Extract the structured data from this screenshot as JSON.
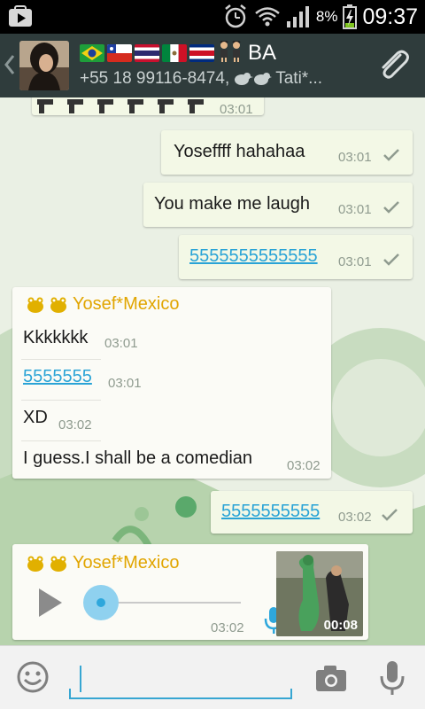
{
  "status_bar": {
    "battery_pct": "8%",
    "time": "09:37",
    "icons": [
      "play-store-icon",
      "alarm-icon",
      "wifi-icon",
      "signal-icon",
      "battery-charging-icon"
    ]
  },
  "header": {
    "title": "BA",
    "subtitle_text": "+55 18 99116-8474,",
    "subtitle_tail": "Tati*...",
    "flags": [
      "brazil",
      "chile",
      "thailand",
      "mexico",
      "costa-rica"
    ],
    "icons": [
      "back-chevron-icon",
      "avatar",
      "dancers-emoji-icon",
      "bird-emoji-icon",
      "attach-paperclip-icon"
    ]
  },
  "messages": {
    "partial_top": {
      "time": "03:01"
    },
    "out1": {
      "text": "Yoseffff hahahaa",
      "time": "03:01"
    },
    "out2": {
      "text": "You make me laugh",
      "time": "03:01"
    },
    "out3": {
      "text": "5555555555555",
      "time": "03:01"
    },
    "in_group1": {
      "sender": "Yosef*Mexico",
      "items": [
        {
          "text": "Kkkkkkk",
          "time": "03:01"
        },
        {
          "text": "5555555",
          "time": "03:01"
        },
        {
          "text": "XD",
          "time": "03:02"
        },
        {
          "text": "I guess.I shall be a comedian",
          "time": "03:02"
        }
      ]
    },
    "out4": {
      "text": "5555555555",
      "time": "03:02"
    },
    "in_group2": {
      "sender": "Yosef*Mexico",
      "voice_time": "03:02",
      "duration": "00:08"
    }
  },
  "input_bar": {
    "placeholder": "",
    "icons": [
      "emoji-icon",
      "camera-icon",
      "mic-icon"
    ]
  },
  "colors": {
    "header_bg": "#2f3c3c",
    "outgoing_bubble": "#f3f8e6",
    "incoming_bubble": "#fbfbf6",
    "sender_name": "#e1a500",
    "link": "#29a3d6",
    "accent": "#37a6d2"
  }
}
